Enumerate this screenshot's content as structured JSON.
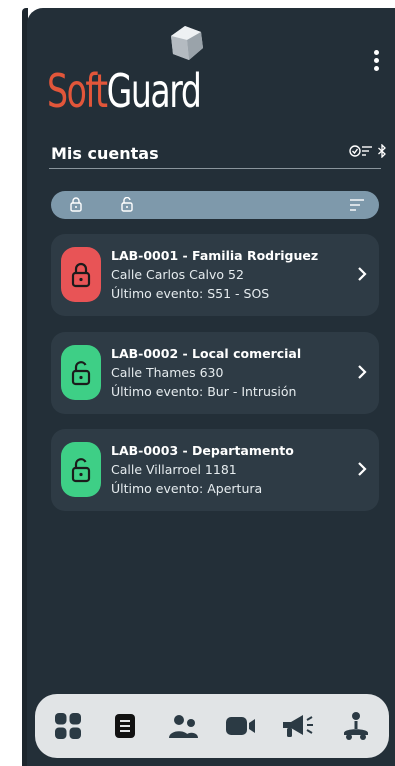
{
  "app": {
    "brand_soft": "Soft",
    "brand_guard": "Guard"
  },
  "header": {
    "title": "Mis cuentas",
    "filter_icon": "check-filter-icon",
    "bluetooth_icon": "bluetooth-icon",
    "menu_icon": "kebab-menu-icon"
  },
  "filter_bar": {
    "icons": [
      "lock-closed-icon",
      "lock-open-icon"
    ],
    "sort_icon": "sort-icon"
  },
  "accounts": [
    {
      "title": "LAB-0001 - Familia Rodriguez",
      "address": "Calle Carlos Calvo 52",
      "last_event": "Último evento: S51 - SOS",
      "status": "alarm",
      "status_color": "#e85456",
      "icon": "lock-closed-icon"
    },
    {
      "title": "LAB-0002 - Local comercial",
      "address": "Calle Thames 630",
      "last_event": "Último evento: Bur - Intrusión",
      "status": "disarmed",
      "status_color": "#3ecf86",
      "icon": "lock-open-icon"
    },
    {
      "title": "LAB-0003 - Departamento",
      "address": "Calle Villarroel 1181",
      "last_event": "Último evento: Apertura",
      "status": "disarmed",
      "status_color": "#3ecf86",
      "icon": "lock-open-icon"
    }
  ],
  "bottom_nav": {
    "items": [
      "dashboard-grid-icon",
      "accounts-list-icon",
      "users-icon",
      "camera-icon",
      "megaphone-icon",
      "assistance-icon"
    ],
    "active": "accounts-list-icon"
  },
  "colors": {
    "background": "#232f38",
    "card": "#2e3b45",
    "accent_soft": "#e2563a",
    "filter_bar": "#7e99ab",
    "navbar": "#e1e4e6"
  }
}
